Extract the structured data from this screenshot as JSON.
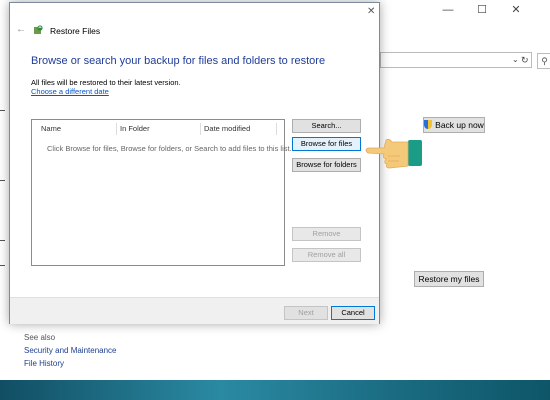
{
  "background_window": {
    "controls": {
      "minimize": "—",
      "maximize": "☐",
      "close": "✕"
    },
    "address_bar": {
      "dropdown": "⌄",
      "refresh": "↻",
      "search": "⚲"
    },
    "back_up_now_label": "Back up now",
    "restore_my_files_label": "Restore my files",
    "see_also": {
      "title": "See also",
      "links": [
        "Security and Maintenance",
        "File History"
      ]
    }
  },
  "dialog": {
    "title": "Restore Files",
    "close_glyph": "✕",
    "back_glyph": "←",
    "heading": "Browse or search your backup for files and folders to restore",
    "note": "All files will be restored to their latest version.",
    "choose_date_link": "Choose a different date",
    "file_list": {
      "columns": [
        "Name",
        "In Folder",
        "Date modified"
      ],
      "hint": "Click Browse for files, Browse for folders, or Search to add files to this list."
    },
    "buttons": {
      "search": "Search...",
      "browse_files": "Browse for files",
      "browse_folders": "Browse for folders",
      "remove": "Remove",
      "remove_all": "Remove all"
    },
    "footer": {
      "next": "Next",
      "cancel": "Cancel"
    }
  },
  "colors": {
    "desktop": "#1f6f86",
    "heading": "#1f3d99",
    "link": "#0a55c8",
    "hand_skin": "#f5c97a",
    "hand_cuff": "#1a9c86"
  }
}
